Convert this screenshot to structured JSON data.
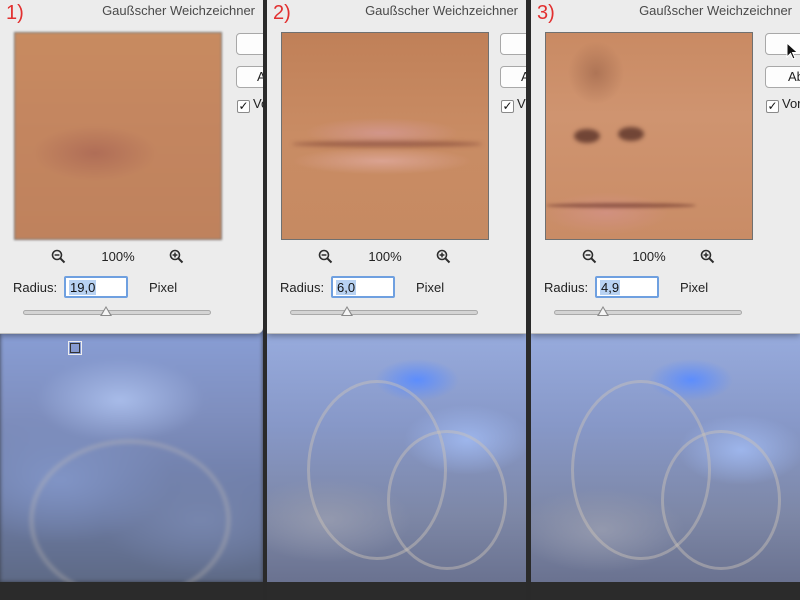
{
  "panels": [
    {
      "step": "1)",
      "dialog_title": "Gaußscher Weichzeichner",
      "zoom": "100%",
      "radius_label": "Radius:",
      "radius_value": "19,0",
      "radius_unit": "Pixel",
      "ok_label": "",
      "cancel_label": "Ab",
      "preview_label": "Vo",
      "preview_checked": true,
      "slider_level_pct": 44
    },
    {
      "step": "2)",
      "dialog_title": "Gaußscher Weichzeichner",
      "zoom": "100%",
      "radius_label": "Radius:",
      "radius_value": "6,0",
      "radius_unit": "Pixel",
      "ok_label": "",
      "cancel_label": "A",
      "preview_label": "V",
      "preview_checked": true,
      "slider_level_pct": 30
    },
    {
      "step": "3)",
      "dialog_title": "Gaußscher Weichzeichner",
      "zoom": "100%",
      "radius_label": "Radius:",
      "radius_value": "4,9",
      "radius_unit": "Pixel",
      "ok_label": "",
      "cancel_label": "Ab",
      "preview_label": "Vor",
      "preview_checked": true,
      "slider_level_pct": 26
    }
  ],
  "icons": {
    "zoom_out": "zoom-out-icon",
    "zoom_in": "zoom-in-icon",
    "checkbox": "checkmark-icon",
    "cursor": "mouse-pointer-icon"
  },
  "colors": {
    "step_label": "#e23030",
    "dialog_bg": "#ececec",
    "input_focus": "#6fa0e0",
    "selection": "#b8d2f2"
  }
}
